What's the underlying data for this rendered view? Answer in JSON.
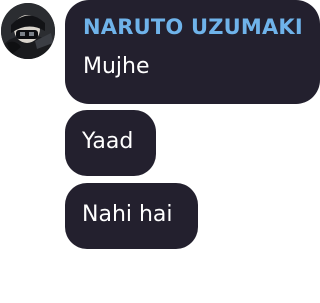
{
  "avatar": {
    "icon": "user-avatar-icon"
  },
  "messages": [
    {
      "sender": "NARUTO UZUMAKI",
      "text": "Mujhe"
    },
    {
      "text": "Yaad"
    },
    {
      "text": "Nahi hai"
    }
  ],
  "colors": {
    "bubble_bg": "#23202e",
    "sender_name": "#6fb3ea",
    "message_text": "#ffffff"
  }
}
